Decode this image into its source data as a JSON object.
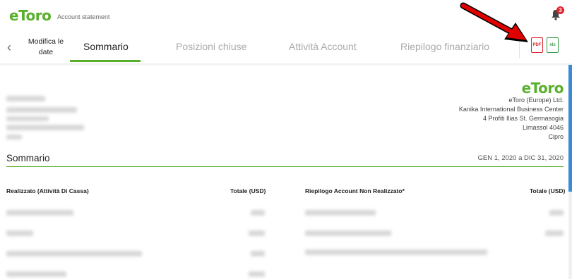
{
  "header": {
    "logo_text": "eToro",
    "subtitle": "Account statement",
    "notification_count": "3"
  },
  "nav": {
    "modify_dates_label": "Modifica le date",
    "tabs": [
      {
        "label": "Sommario",
        "active": true
      },
      {
        "label": "Posizioni chiuse",
        "active": false
      },
      {
        "label": "Attività Account",
        "active": false
      },
      {
        "label": "Riepilogo finanziario",
        "active": false
      }
    ],
    "downloads": {
      "pdf_label": "PDF",
      "xls_label": "xls"
    }
  },
  "company": {
    "logo_text": "eToro",
    "lines": [
      "eToro (Europe) Ltd.",
      "Kanika International Business Center",
      "4 Profiti Ilias St. Germasogia",
      "Limassol 4046",
      "Cipro"
    ]
  },
  "summary": {
    "title": "Sommario",
    "date_range": "GEN 1, 2020 a DIC 31, 2020",
    "left_header": "Realizzato (Attività Di Cassa)",
    "left_total_header": "Totale (USD)",
    "right_header": "Riepilogo Account Non Realizzato*",
    "right_total_header": "Totale (USD)"
  },
  "colors": {
    "brand_green": "#59b02c",
    "arrow_red": "#e00000",
    "scroll_blue": "#3a8bd6"
  }
}
